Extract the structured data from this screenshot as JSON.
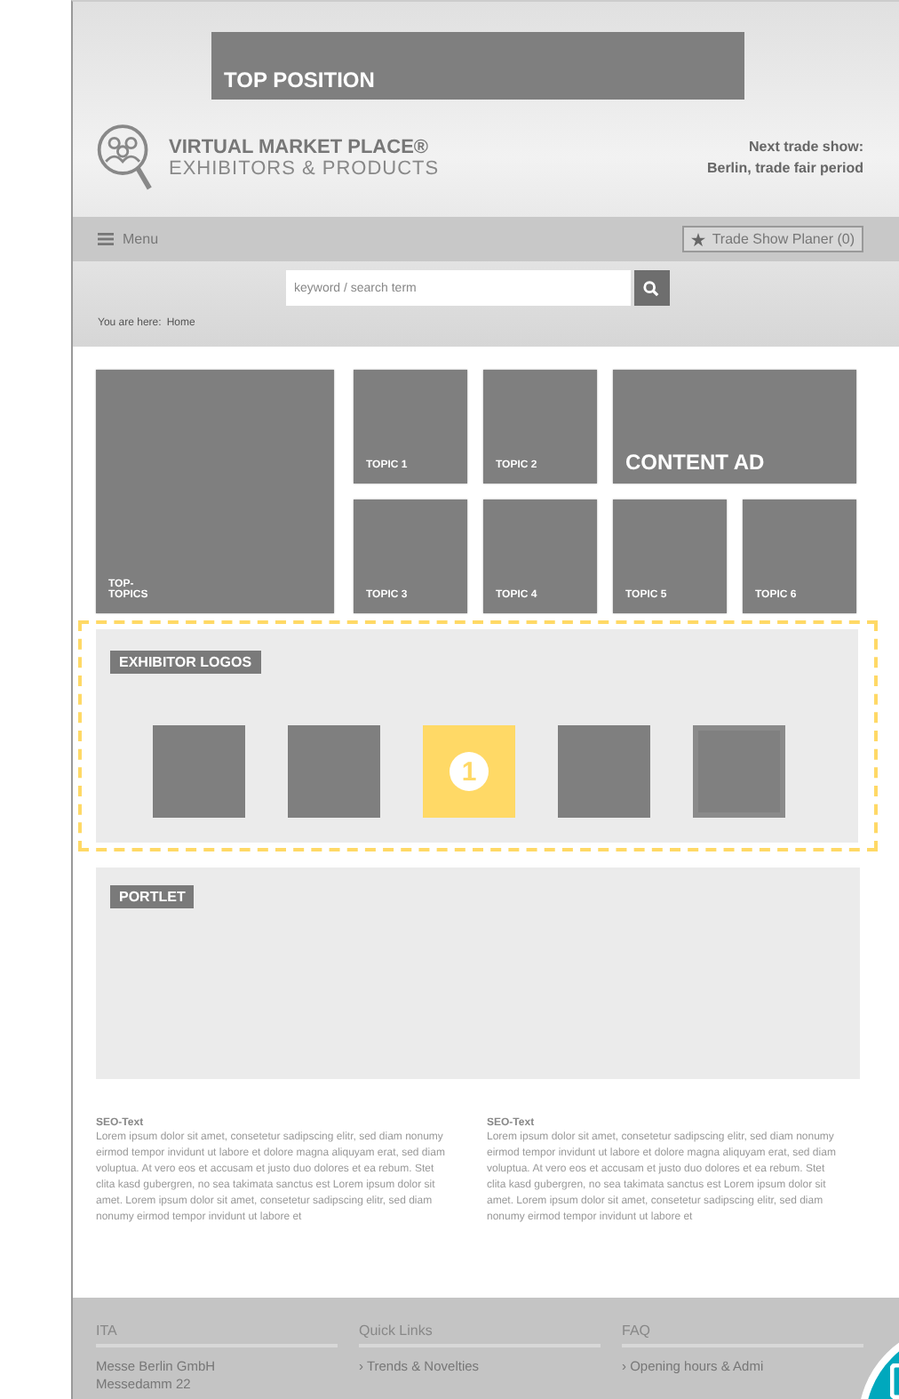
{
  "top_banner": {
    "label": "TOP POSITION"
  },
  "header": {
    "brand_title": "VIRTUAL MARKET PLACE®",
    "brand_subtitle": "EXHIBITORS & PRODUCTS",
    "next_show_label": "Next trade show:",
    "next_show_value": "Berlin, trade fair period"
  },
  "nav": {
    "menu_label": "Menu",
    "planner_label": "Trade Show Planer (0)"
  },
  "search": {
    "placeholder": "keyword / search term"
  },
  "breadcrumb": {
    "label": "You are here:",
    "current": "Home"
  },
  "tiles": [
    {
      "kind": "main",
      "label": "TOP-TOPICS"
    },
    {
      "kind": "topic",
      "label": "TOPIC 1"
    },
    {
      "kind": "topic",
      "label": "TOPIC 2"
    },
    {
      "kind": "ad",
      "label": "CONTENT AD"
    },
    {
      "kind": "topic",
      "label": "TOPIC 3"
    },
    {
      "kind": "topic",
      "label": "TOPIC 4"
    },
    {
      "kind": "topic",
      "label": "TOPIC 5"
    },
    {
      "kind": "topic",
      "label": "TOPIC 6"
    }
  ],
  "exhibitor_logos": {
    "label": "EXHIBITOR LOGOS",
    "logos": [
      {
        "kind": "plain"
      },
      {
        "kind": "plain"
      },
      {
        "kind": "marked",
        "marker": "1"
      },
      {
        "kind": "plain"
      },
      {
        "kind": "framed"
      }
    ]
  },
  "portlet": {
    "label": "PORTLET"
  },
  "seo_texts": [
    {
      "title": "SEO-Text",
      "body": "Lorem ipsum dolor sit amet, consetetur sadipscing elitr, sed diam nonumy eirmod tempor invidunt ut labore et dolore magna aliquyam erat, sed diam voluptua. At vero eos et accusam et justo duo dolores et ea rebum. Stet clita kasd gubergren, no sea takimata sanctus est Lorem ipsum dolor sit amet. Lorem ipsum dolor sit amet, consetetur sadipscing elitr, sed diam nonumy eirmod tempor invidunt ut labore et"
    },
    {
      "title": "SEO-Text",
      "body": "Lorem ipsum dolor sit amet, consetetur sadipscing elitr, sed diam nonumy eirmod tempor invidunt ut labore et dolore magna aliquyam erat, sed diam voluptua. At vero eos et accusam et justo duo dolores et ea rebum. Stet clita kasd gubergren, no sea takimata sanctus est Lorem ipsum dolor sit amet. Lorem ipsum dolor sit amet, consetetur sadipscing elitr, sed diam nonumy eirmod tempor invidunt ut labore et"
    }
  ],
  "footer": {
    "columns": [
      {
        "heading": "ITA",
        "lines": [
          "Messe Berlin GmbH",
          "Messedamm 22"
        ]
      },
      {
        "heading": "Quick Links",
        "lines": [
          "› Trends & Novelties"
        ]
      },
      {
        "heading": "FAQ",
        "lines": [
          "› Opening hours & Admi"
        ]
      }
    ]
  }
}
